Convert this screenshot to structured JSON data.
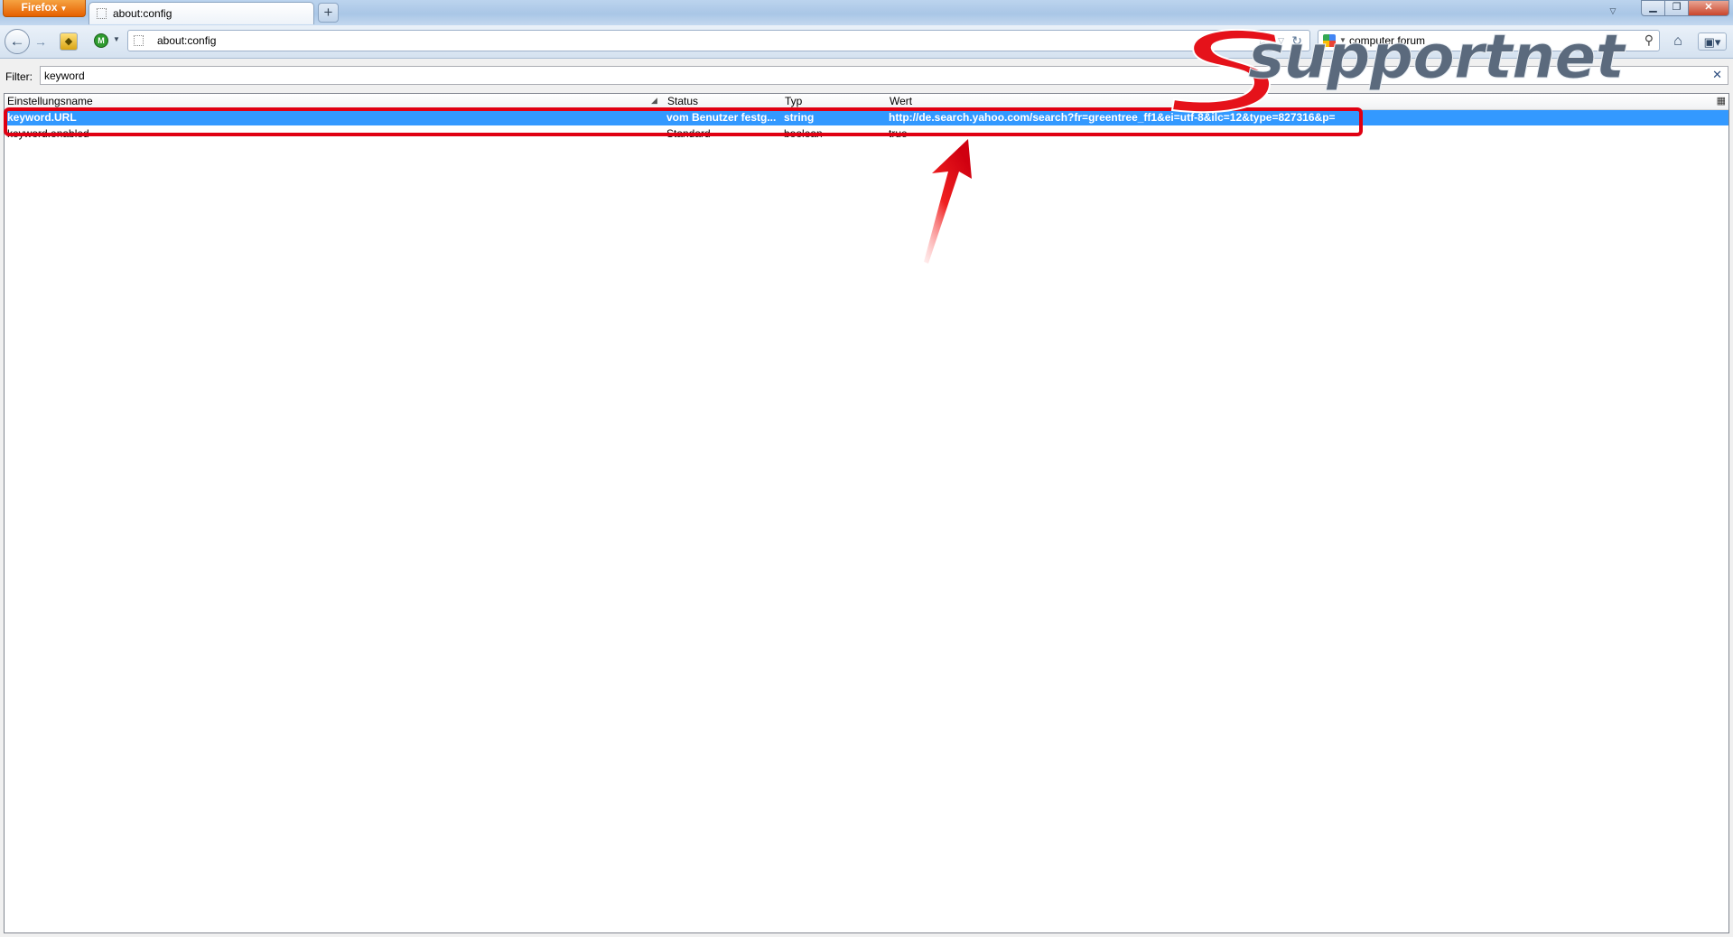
{
  "browser": {
    "menu_button": "Firefox",
    "tab_title": "about:config",
    "new_tab": "+",
    "url": "about:config",
    "search_query": "computer forum"
  },
  "filter": {
    "label": "Filter:",
    "value": "keyword"
  },
  "columns": {
    "name": "Einstellungsname",
    "status": "Status",
    "type": "Typ",
    "value": "Wert"
  },
  "rows": [
    {
      "name": "keyword.URL",
      "status": "vom Benutzer festg...",
      "type": "string",
      "value": "http://de.search.yahoo.com/search?fr=greentree_ff1&ei=utf-8&ilc=12&type=827316&p=",
      "selected": true
    },
    {
      "name": "keyword.enabled",
      "status": "Standard",
      "type": "boolean",
      "value": "true",
      "selected": false
    }
  ],
  "watermark": {
    "logo_text": "supportnet"
  },
  "colors": {
    "selection": "#3399ff",
    "highlight": "#e00012",
    "firefox_orange": "#e66000"
  }
}
